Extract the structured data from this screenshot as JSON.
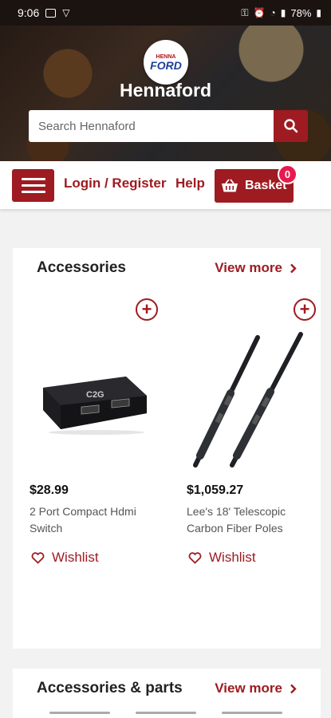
{
  "status_bar": {
    "time": "9:06",
    "battery": "78%"
  },
  "header": {
    "logo_top": "HENNA",
    "logo_main": "FORD",
    "brand": "Hennaford",
    "search_placeholder": "Search Hennaford"
  },
  "nav": {
    "login": "Login / Register",
    "help": "Help",
    "basket": "Basket",
    "basket_count": "0"
  },
  "sections": [
    {
      "title": "Accessories",
      "view_more": "View more",
      "products": [
        {
          "price": "$28.99",
          "name": "2 Port Compact Hdmi Switch",
          "wishlist": "Wishlist"
        },
        {
          "price": "$1,059.27",
          "name": "Lee's 18' Telescopic Carbon Fiber Poles",
          "wishlist": "Wishlist"
        }
      ]
    },
    {
      "title": "Accessories & parts",
      "view_more": "View more"
    }
  ],
  "colors": {
    "brand_red": "#9e1b21",
    "badge_pink": "#e8194f"
  }
}
